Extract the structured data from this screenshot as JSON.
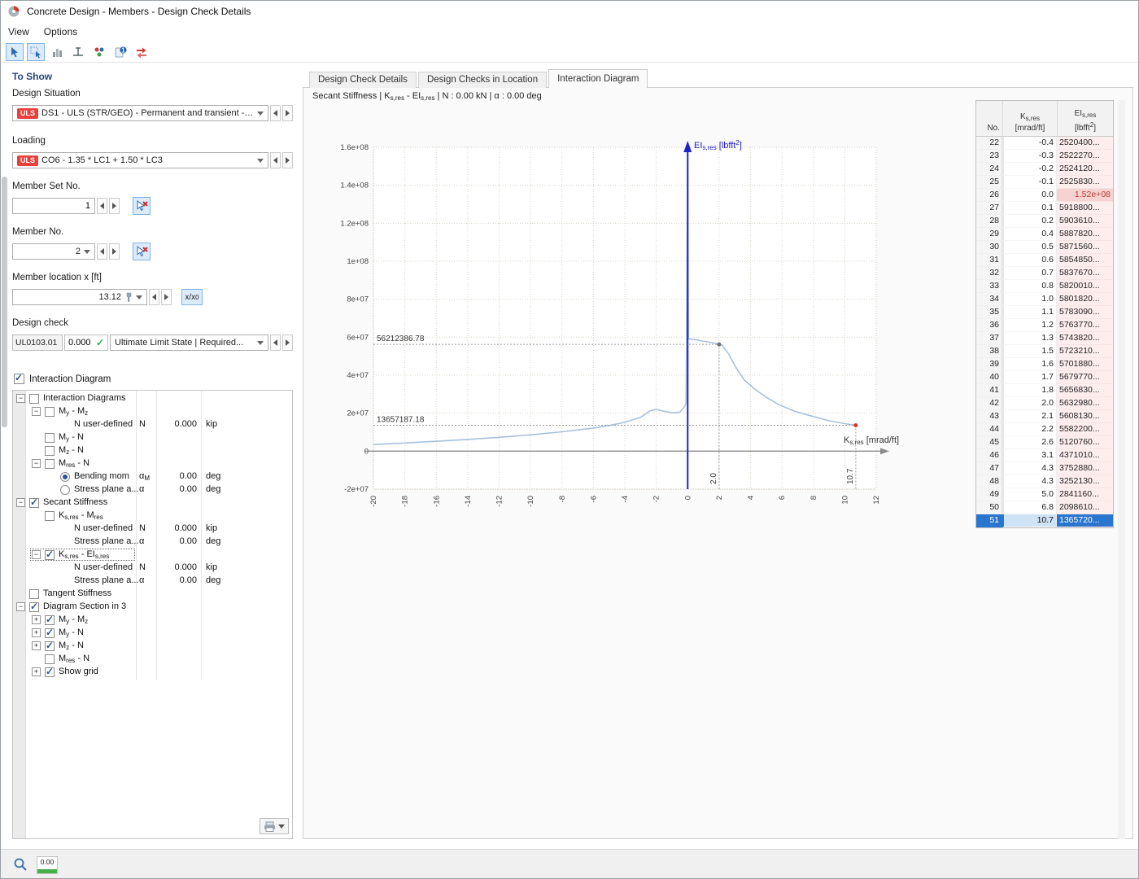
{
  "window": {
    "title": "Concrete Design - Members - Design Check Details"
  },
  "menubar": {
    "items": [
      "View",
      "Options"
    ]
  },
  "toolbar": {
    "icons": [
      "pointer-icon",
      "pick-window-icon",
      "chart-icon",
      "dimension-icon",
      "color-points-icon",
      "numbering-icon",
      "reset-red-icon"
    ]
  },
  "tabs": [
    {
      "label": "Design Check Details",
      "active": false
    },
    {
      "label": "Design Checks in Location",
      "active": false
    },
    {
      "label": "Interaction Diagram",
      "active": true
    }
  ],
  "chart_header": "Secant Stiffness | K_{s,res} - EI_{s,res} | N : 0.00 kN | α : 0.00 deg",
  "sidebar": {
    "title": "To Show",
    "design_situation": {
      "label": "Design Situation",
      "badge": "ULS",
      "value": "DS1 - ULS (STR/GEO) - Permanent and transient - E..."
    },
    "loading": {
      "label": "Loading",
      "badge": "ULS",
      "value": "CO6 - 1.35 * LC1 + 1.50 * LC3"
    },
    "member_set_no": {
      "label": "Member Set No.",
      "value": "1"
    },
    "member_no": {
      "label": "Member No.",
      "value": "2"
    },
    "member_location": {
      "label": "Member location x [ft]",
      "value": "13.12",
      "toggle": "x/x_{0}"
    },
    "design_check": {
      "label": "Design check",
      "code": "UL0103.01",
      "ratio": "0.000",
      "value": "Ultimate Limit State | Required..."
    },
    "interaction_diagram": {
      "label": "Interaction Diagram",
      "checked": true
    },
    "tree": [
      {
        "i": 0,
        "e": "-",
        "c": "cb",
        "on": false,
        "label": "Interaction Diagrams"
      },
      {
        "i": 1,
        "e": "-",
        "c": "cb",
        "on": false,
        "label": "M_{y} - M_{z}"
      },
      {
        "i": 2,
        "e": "",
        "c": "",
        "label": "N user-defined",
        "sym": "N",
        "val": "0.000",
        "unit": "kip"
      },
      {
        "i": 1,
        "e": "",
        "c": "cb",
        "on": false,
        "label": "M_{y} - N"
      },
      {
        "i": 1,
        "e": "",
        "c": "cb",
        "on": false,
        "label": "M_{z} - N"
      },
      {
        "i": 1,
        "e": "-",
        "c": "cb",
        "on": false,
        "label": "M_{res} - N"
      },
      {
        "i": 2,
        "e": "",
        "c": "radio",
        "on": true,
        "label": "Bending mom",
        "sym": "α_{M}",
        "val": "0.00",
        "unit": "deg"
      },
      {
        "i": 2,
        "e": "",
        "c": "radio",
        "on": false,
        "label": "Stress plane a...",
        "sym": "α",
        "val": "0.00",
        "unit": "deg"
      },
      {
        "i": 0,
        "e": "-",
        "c": "cb",
        "on": true,
        "label": "Secant Stiffness"
      },
      {
        "i": 1,
        "e": "",
        "c": "cb",
        "on": false,
        "label": "K_{s,res} - M_{res}"
      },
      {
        "i": 2,
        "e": "",
        "c": "",
        "label": "N user-defined",
        "sym": "N",
        "val": "0.000",
        "unit": "kip"
      },
      {
        "i": 2,
        "e": "",
        "c": "",
        "label": "Stress plane a...",
        "sym": "α",
        "val": "0.00",
        "unit": "deg"
      },
      {
        "i": 1,
        "e": "-",
        "c": "cb",
        "on": true,
        "sel": true,
        "label": "K_{s,res} - EI_{s,res}"
      },
      {
        "i": 2,
        "e": "",
        "c": "",
        "label": "N user-defined",
        "sym": "N",
        "val": "0.000",
        "unit": "kip"
      },
      {
        "i": 2,
        "e": "",
        "c": "",
        "label": "Stress plane a...",
        "sym": "α",
        "val": "0.00",
        "unit": "deg"
      },
      {
        "i": 0,
        "e": "",
        "c": "cb",
        "on": false,
        "label": "Tangent Stiffness"
      },
      {
        "i": 0,
        "e": "-",
        "c": "cb",
        "on": true,
        "label": "Diagram Section in 3"
      },
      {
        "i": 1,
        "e": "+",
        "c": "cb",
        "on": true,
        "label": "M_{y} - M_{z}"
      },
      {
        "i": 1,
        "e": "+",
        "c": "cb",
        "on": true,
        "label": "M_{y} - N"
      },
      {
        "i": 1,
        "e": "+",
        "c": "cb",
        "on": true,
        "label": "M_{z} - N"
      },
      {
        "i": 1,
        "e": "",
        "c": "cb",
        "on": false,
        "label": "M_{res} - N"
      },
      {
        "i": 1,
        "e": "+",
        "c": "cb",
        "on": true,
        "label": "Show grid"
      }
    ]
  },
  "chart_data": {
    "type": "line",
    "title": "Secant Stiffness | K_{s,res} - EI_{s,res} | N : 0.00 kN | α : 0.00 deg",
    "xlabel": "K_{s,res} [mrad/ft]",
    "ylabel": "EI_{s,res} [lbfft^{2}]",
    "xlim": [
      -20,
      12
    ],
    "ylim": [
      -20000000,
      160000000
    ],
    "grid": true,
    "xticks": [
      -20,
      -18,
      -16,
      -14,
      -12,
      -10,
      -8,
      -6,
      -4,
      -2,
      0,
      2,
      4,
      6,
      8,
      10,
      12
    ],
    "xtick_labels": [
      "-20",
      "-18",
      "-16",
      "-14",
      "-12",
      "-10",
      "-8",
      "-6",
      "-4",
      "-2",
      "0",
      "2",
      "4",
      "6",
      "8",
      "10",
      "12"
    ],
    "yticks": [
      -20000000,
      0,
      20000000,
      40000000,
      60000000,
      80000000,
      100000000,
      120000000,
      140000000,
      160000000
    ],
    "ytick_labels": [
      "-2e+07",
      "0",
      "2e+07",
      "4e+07",
      "6e+07",
      "8e+07",
      "1e+08",
      "1.2e+08",
      "1.4e+08",
      "1.6e+08"
    ],
    "series": [
      {
        "name": "secant-stiffness-curve",
        "color": "#a7c0de",
        "points": [
          [
            -20,
            3500000
          ],
          [
            -18,
            4300000
          ],
          [
            -16,
            5200000
          ],
          [
            -14,
            6200000
          ],
          [
            -12,
            7300000
          ],
          [
            -10,
            8600000
          ],
          [
            -8,
            10200000
          ],
          [
            -6,
            12200000
          ],
          [
            -5,
            13500000
          ],
          [
            -4,
            15200000
          ],
          [
            -3,
            17800000
          ],
          [
            -2.4,
            21200000
          ],
          [
            -2,
            22000000
          ],
          [
            -1.6,
            21200000
          ],
          [
            -1,
            20200000
          ],
          [
            -0.5,
            20500000
          ],
          [
            -0.2,
            23500000
          ],
          [
            -0.1,
            25300000
          ],
          [
            0,
            152000000
          ],
          [
            0.05,
            59300000
          ],
          [
            0.2,
            59000000
          ],
          [
            0.5,
            58700000
          ],
          [
            0.8,
            58200000
          ],
          [
            1.1,
            57800000
          ],
          [
            1.5,
            57200000
          ],
          [
            2,
            56330000
          ],
          [
            2.2,
            55800000
          ],
          [
            2.6,
            51200000
          ],
          [
            3.1,
            43700000
          ],
          [
            3.6,
            37500000
          ],
          [
            4.3,
            32500000
          ],
          [
            5,
            28400000
          ],
          [
            5.8,
            24500000
          ],
          [
            6.8,
            21000000
          ],
          [
            7.8,
            18700000
          ],
          [
            9,
            16000000
          ],
          [
            10,
            14500000
          ],
          [
            10.7,
            13660000
          ]
        ]
      }
    ],
    "markers": [
      {
        "x": 2.0,
        "y": 56212386.78,
        "label_y": "56212386.78",
        "label_x": "2.0",
        "color": "#6e6e6e"
      },
      {
        "x": 10.7,
        "y": 13657187.18,
        "label_y": "13657187.18",
        "label_x": "10.7",
        "color": "#d9342b"
      }
    ]
  },
  "table": {
    "header_no": "No.",
    "header_ks_1": "K_{s,res}",
    "header_ks_2": "[mrad/ft]",
    "header_ei_1": "EI_{s,res}",
    "header_ei_2": "[lbfft^{2}]",
    "rows": [
      {
        "no": "22",
        "ks": "-0.4",
        "ei": "2520400..."
      },
      {
        "no": "23",
        "ks": "-0.3",
        "ei": "2522270..."
      },
      {
        "no": "24",
        "ks": "-0.2",
        "ei": "2524120..."
      },
      {
        "no": "25",
        "ks": "-0.1",
        "ei": "2525830..."
      },
      {
        "no": "26",
        "ks": "0.0",
        "ei": "1.52e+08",
        "hl": true
      },
      {
        "no": "27",
        "ks": "0.1",
        "ei": "5918800..."
      },
      {
        "no": "28",
        "ks": "0.2",
        "ei": "5903610..."
      },
      {
        "no": "29",
        "ks": "0.4",
        "ei": "5887820..."
      },
      {
        "no": "30",
        "ks": "0.5",
        "ei": "5871560..."
      },
      {
        "no": "31",
        "ks": "0.6",
        "ei": "5854850..."
      },
      {
        "no": "32",
        "ks": "0.7",
        "ei": "5837670..."
      },
      {
        "no": "33",
        "ks": "0.8",
        "ei": "5820010..."
      },
      {
        "no": "34",
        "ks": "1.0",
        "ei": "5801820..."
      },
      {
        "no": "35",
        "ks": "1.1",
        "ei": "5783090..."
      },
      {
        "no": "36",
        "ks": "1.2",
        "ei": "5763770..."
      },
      {
        "no": "37",
        "ks": "1.3",
        "ei": "5743820..."
      },
      {
        "no": "38",
        "ks": "1.5",
        "ei": "5723210..."
      },
      {
        "no": "39",
        "ks": "1.6",
        "ei": "5701880..."
      },
      {
        "no": "40",
        "ks": "1.7",
        "ei": "5679770..."
      },
      {
        "no": "41",
        "ks": "1.8",
        "ei": "5656830..."
      },
      {
        "no": "42",
        "ks": "2.0",
        "ei": "5632980..."
      },
      {
        "no": "43",
        "ks": "2.1",
        "ei": "5608130..."
      },
      {
        "no": "44",
        "ks": "2.2",
        "ei": "5582200..."
      },
      {
        "no": "45",
        "ks": "2.6",
        "ei": "5120760..."
      },
      {
        "no": "46",
        "ks": "3.1",
        "ei": "4371010..."
      },
      {
        "no": "47",
        "ks": "4.3",
        "ei": "3752880..."
      },
      {
        "no": "48",
        "ks": "4.3",
        "ei": "3252130..."
      },
      {
        "no": "49",
        "ks": "5.0",
        "ei": "2841160..."
      },
      {
        "no": "50",
        "ks": "6.8",
        "ei": "2098610..."
      },
      {
        "no": "51",
        "ks": "10.7",
        "ei": "1365720...",
        "selected": true
      }
    ]
  },
  "statusbar": {
    "zoom_value": "0.00"
  }
}
